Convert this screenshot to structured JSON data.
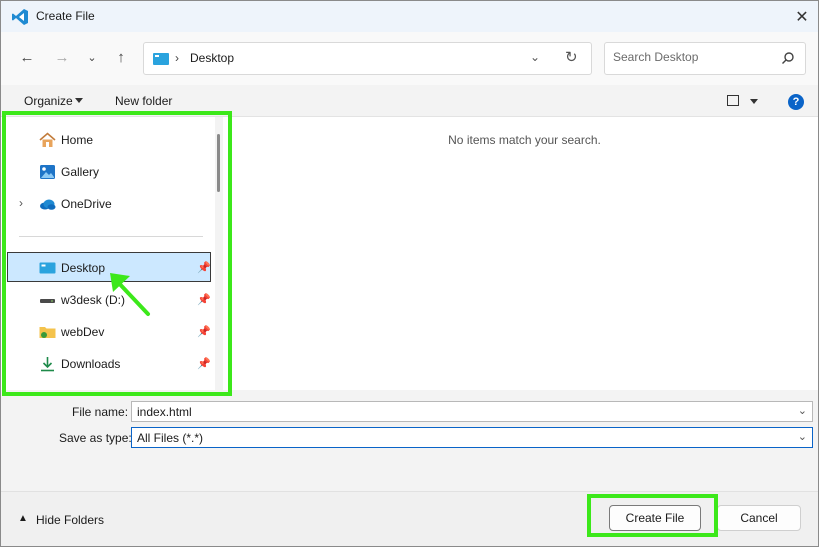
{
  "window": {
    "title": "Create File",
    "close": "✕"
  },
  "address_bar": {
    "location": "Desktop",
    "separator": "›",
    "search_placeholder": "Search Desktop"
  },
  "toolbar": {
    "organize": "Organize",
    "new_folder": "New folder",
    "help": "?"
  },
  "nav_pane": {
    "items": [
      {
        "label": "Home",
        "icon": "home-icon"
      },
      {
        "label": "Gallery",
        "icon": "gallery-icon"
      },
      {
        "label": "OneDrive",
        "icon": "cloud-icon",
        "expandable": true
      },
      {
        "label": "Desktop",
        "icon": "desktop-folder-icon",
        "selected": true,
        "pinned": true
      },
      {
        "label": "w3desk (D:)",
        "icon": "drive-icon",
        "pinned": true
      },
      {
        "label": "webDev",
        "icon": "folder-icon",
        "pinned": true
      },
      {
        "label": "Downloads",
        "icon": "download-icon",
        "pinned": true
      }
    ]
  },
  "content": {
    "empty_message": "No items match your search."
  },
  "fields": {
    "file_name_label": "File name:",
    "file_name_value": "index.html",
    "save_type_label": "Save as type:",
    "save_type_value": "All Files (*.*)"
  },
  "footer": {
    "hide_folders": "Hide Folders",
    "create_button": "Create File",
    "cancel_button": "Cancel"
  },
  "colors": {
    "annotation": "#3ce81a",
    "selection": "#cce8ff",
    "accent": "#0a64c8"
  }
}
